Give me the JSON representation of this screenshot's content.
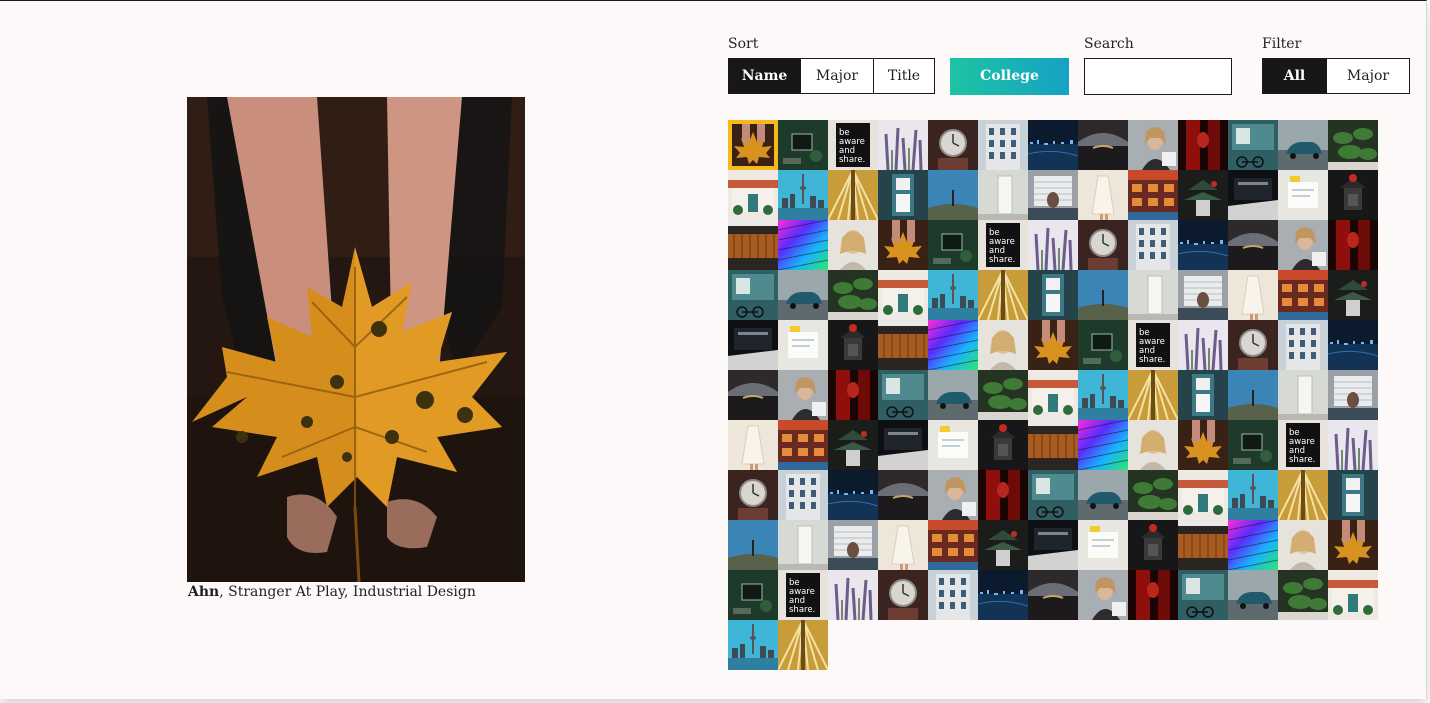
{
  "featured": {
    "name": "Ahn",
    "caption_rest": ", Stranger At Play, Industrial Design"
  },
  "controls": {
    "sort_label": "Sort",
    "sort_options": [
      "Name",
      "Major",
      "Title"
    ],
    "sort_active": "Name",
    "college_label": "College",
    "search_label": "Search",
    "search_value": "",
    "filter_label": "Filter",
    "filter_options": [
      "All",
      "Major"
    ],
    "filter_active": "All"
  },
  "colors": {
    "selected_border": "#f5b91c",
    "button_active": "#171717",
    "college_gradient": [
      "#1dc4a2",
      "#15a2c4"
    ]
  },
  "gallery": {
    "selected_index": 0,
    "thumbnail_count": 132,
    "sequence": [
      "leaf",
      "phone",
      "aware",
      "lavender",
      "watch",
      "building",
      "city-night",
      "lake",
      "woman",
      "red",
      "bike",
      "car",
      "plant",
      "house",
      "toronto",
      "tower",
      "door",
      "sky",
      "white",
      "blinds",
      "dress",
      "shop",
      "pagoda",
      "dark",
      "note",
      "lantern",
      "wood",
      "rainbow",
      "blonde"
    ]
  }
}
